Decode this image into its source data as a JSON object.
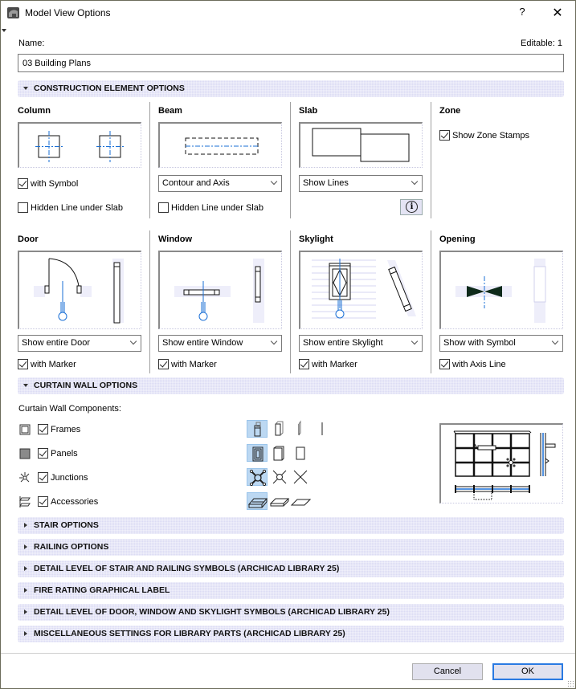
{
  "window": {
    "title": "Model View Options",
    "help_label": "?",
    "close_label": "✕",
    "icons": {
      "app": "archicad-app-icon",
      "help": "help-icon",
      "close": "close-icon"
    }
  },
  "name": {
    "label": "Name:",
    "value": "03 Building Plans",
    "editable": "Editable: 1"
  },
  "construction": {
    "header": "CONSTRUCTION ELEMENT OPTIONS",
    "expanded": true,
    "column": {
      "title": "Column",
      "with_symbol": {
        "label": "with Symbol",
        "checked": true
      },
      "hidden_line": {
        "label": "Hidden Line under Slab",
        "checked": false
      }
    },
    "beam": {
      "title": "Beam",
      "display": "Contour and Axis",
      "hidden_line": {
        "label": "Hidden Line under Slab",
        "checked": false
      }
    },
    "slab": {
      "title": "Slab",
      "display": "Show Lines",
      "info_icon": "info-icon"
    },
    "zone": {
      "title": "Zone",
      "show_stamps": {
        "label": "Show Zone Stamps",
        "checked": true
      }
    },
    "door": {
      "title": "Door",
      "display": "Show entire Door",
      "with_marker": {
        "label": "with Marker",
        "checked": true
      }
    },
    "window": {
      "title": "Window",
      "display": "Show entire Window",
      "with_marker": {
        "label": "with Marker",
        "checked": true
      }
    },
    "skylight": {
      "title": "Skylight",
      "display": "Show entire Skylight",
      "with_marker": {
        "label": "with Marker",
        "checked": true
      }
    },
    "opening": {
      "title": "Opening",
      "display": "Show with Symbol",
      "with_axis": {
        "label": "with Axis Line",
        "checked": true
      }
    }
  },
  "curtain_wall": {
    "header": "CURTAIN WALL OPTIONS",
    "expanded": true,
    "components_label": "Curtain Wall Components:",
    "components": [
      {
        "label": "Frames",
        "checked": true,
        "icon": "frames-icon",
        "selected_option": 1,
        "option_count": 4
      },
      {
        "label": "Panels",
        "checked": true,
        "icon": "panels-icon",
        "selected_option": 1,
        "option_count": 3
      },
      {
        "label": "Junctions",
        "checked": true,
        "icon": "junctions-icon",
        "selected_option": 1,
        "option_count": 3
      },
      {
        "label": "Accessories",
        "checked": true,
        "icon": "accessories-icon",
        "selected_option": 1,
        "option_count": 3
      }
    ]
  },
  "collapsed_sections": [
    "STAIR OPTIONS",
    "RAILING OPTIONS",
    "DETAIL LEVEL OF STAIR AND RAILING SYMBOLS (ARCHICAD LIBRARY 25)",
    "FIRE RATING GRAPHICAL LABEL",
    "DETAIL LEVEL OF DOOR, WINDOW AND SKYLIGHT SYMBOLS (ARCHICAD LIBRARY 25)",
    "MISCELLANEOUS SETTINGS FOR LIBRARY PARTS (ARCHICAD LIBRARY 25)"
  ],
  "footer": {
    "cancel": "Cancel",
    "ok": "OK"
  },
  "colors": {
    "section_bg": "#dcdcf4",
    "axis_blue": "#1a6fd6",
    "selected_option_bg": "#bcd8f2",
    "default_button_border": "#2a7ae2"
  }
}
